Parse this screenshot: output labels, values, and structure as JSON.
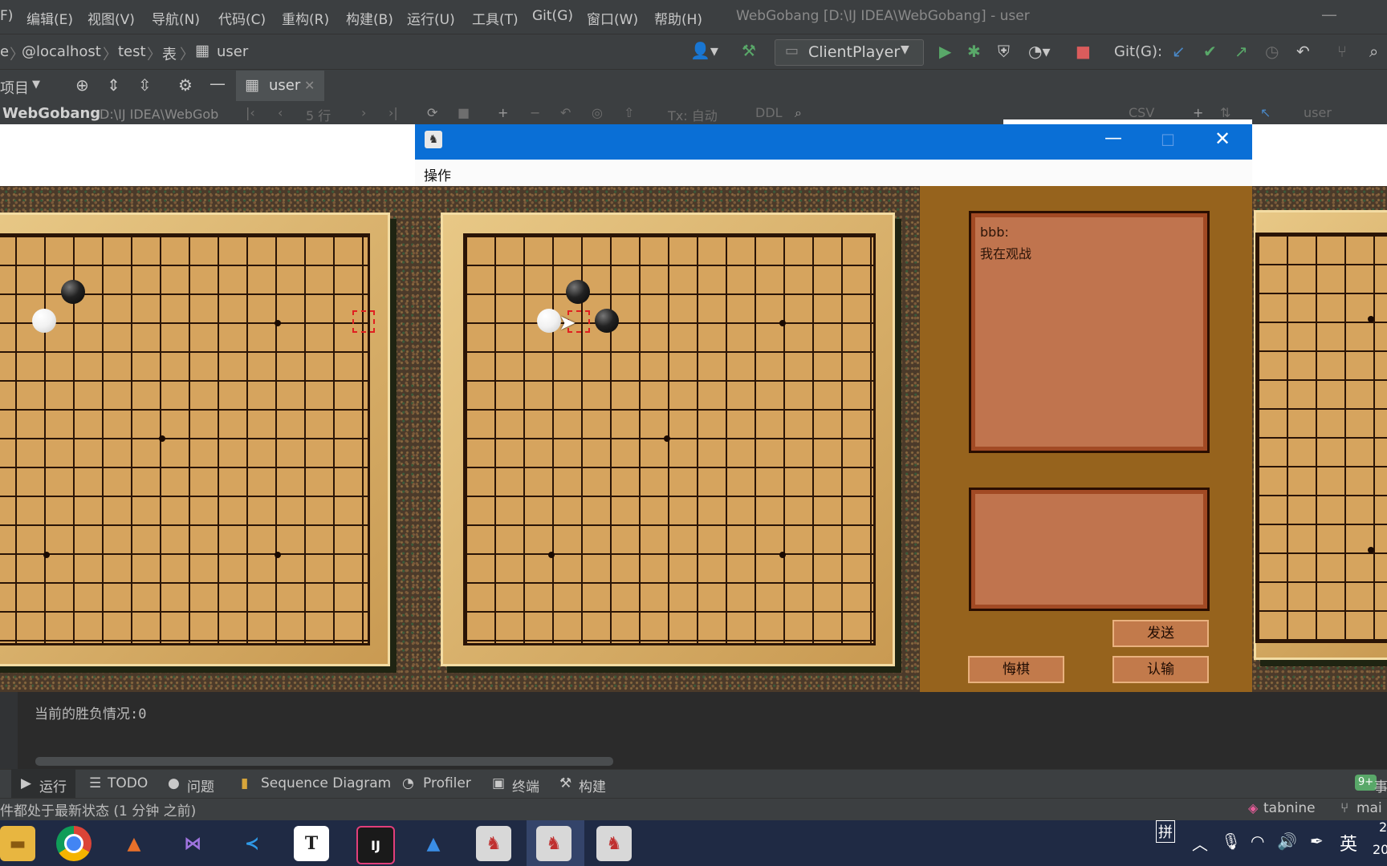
{
  "ide": {
    "menu": [
      "F)",
      "编辑(E)",
      "视图(V)",
      "导航(N)",
      "代码(C)",
      "重构(R)",
      "构建(B)",
      "运行(U)",
      "工具(T)",
      "Git(G)",
      "窗口(W)",
      "帮助(H)"
    ],
    "window_title": "WebGobang [D:\\IJ IDEA\\WebGobang] - user",
    "breadcrumb": [
      "e",
      "@localhost",
      "test",
      "表",
      "user"
    ],
    "run_config": "ClientPlayer",
    "git_label": "Git(G):",
    "project_dropdown": "项目",
    "editor_tab": "user",
    "project_name": "WebGobang",
    "project_path": "D:\\IJ IDEA\\WebGob",
    "rows_label": "5 行",
    "tx_label": "Tx: 自动",
    "ddl_label": "DDL",
    "csv_label": "CSV",
    "user_selector": "user"
  },
  "game_window": {
    "menu": "操作",
    "chat_sender": "bbb:",
    "chat_message": "我在观战",
    "send_button": "发送",
    "undo_button": "悔棋",
    "resign_button": "认输"
  },
  "console": {
    "output": "当前的胜负情况:0"
  },
  "toolwindows": [
    "运行",
    "TODO",
    "问题",
    "Sequence Diagram",
    "Profiler",
    "终端",
    "构建"
  ],
  "status": {
    "text": "件都处于最新状态 (1 分钟 之前)",
    "tabnine": "tabnine",
    "branch": "mai",
    "notif_badge": "9+",
    "notif_label": "事"
  },
  "taskbar": {
    "ime": "拼",
    "lang": "英",
    "clock_partial": "2",
    "year_partial": "20",
    "apps": [
      "file-explorer",
      "chrome",
      "matlab",
      "visual-studio",
      "vscode",
      "typora",
      "intellij",
      "remote-desktop",
      "java-app-1",
      "java-app-2",
      "java-app-3"
    ],
    "icon_labels": {
      "typora": "T",
      "intellij": "IJ"
    }
  },
  "colors": {
    "ide_bg": "#3c3f41",
    "editor_bg": "#2b2b2b",
    "game_title_blue": "#0a6fd6",
    "side_panel": "#96631d",
    "chat_box": "#c0744e",
    "taskbar": "#1f2a44"
  }
}
